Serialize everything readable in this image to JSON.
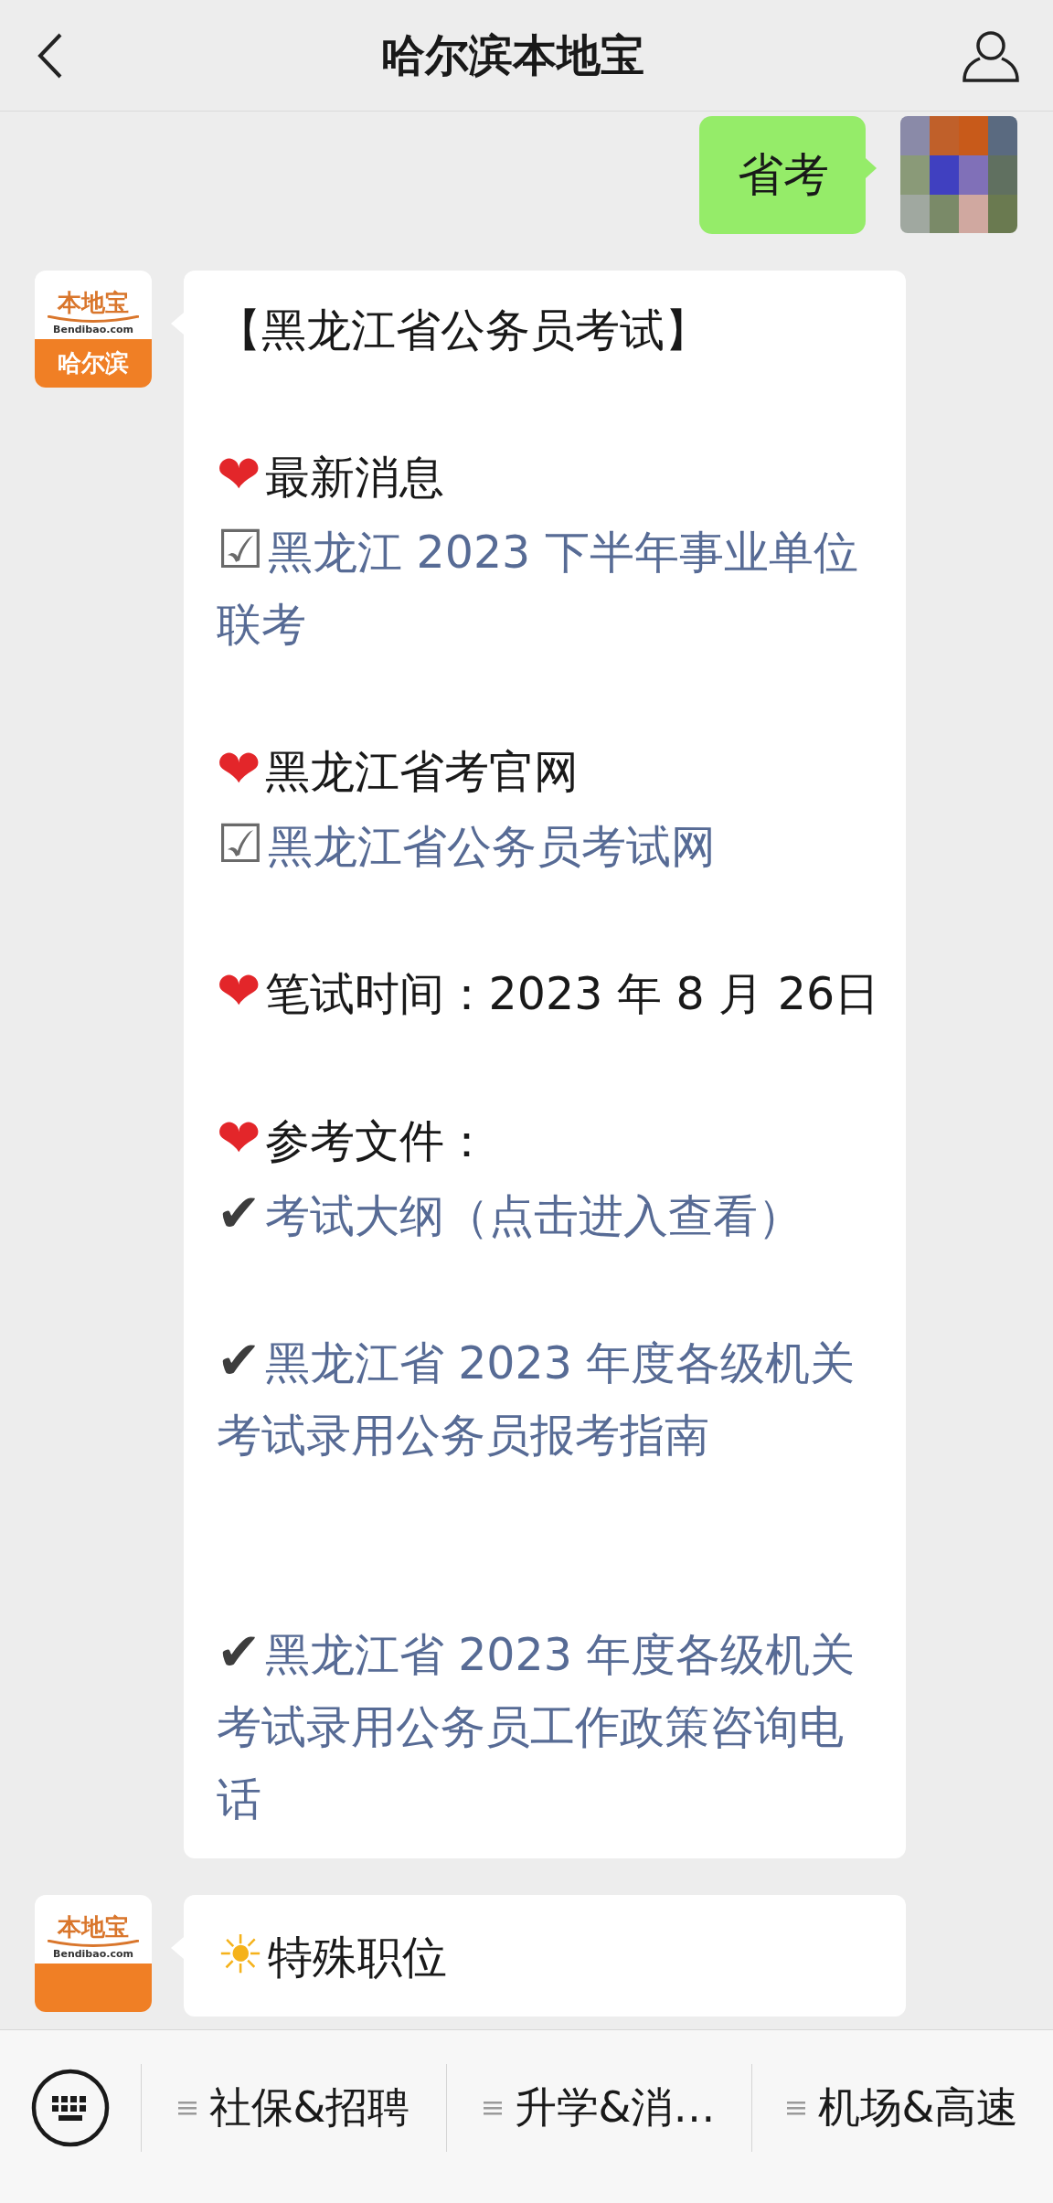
{
  "header": {
    "title": "哈尔滨本地宝"
  },
  "messages": [
    {
      "kind": "outgoing",
      "text": "省考"
    },
    {
      "kind": "incoming",
      "avatar_logo": [
        "本地宝",
        "Bendibao.com",
        "哈尔滨"
      ],
      "lines": [
        {
          "kind": "title",
          "text": "【黑龙江省公务员考试】"
        },
        {
          "kind": "blank"
        },
        {
          "kind": "heading",
          "text": "❤最新消息"
        },
        {
          "kind": "boxlink",
          "text": "☑黑龙江 2023 下半年事业单位联考"
        },
        {
          "kind": "blank"
        },
        {
          "kind": "heading",
          "text": "❤黑龙江省考官网"
        },
        {
          "kind": "boxlink",
          "text": "☑黑龙江省公务员考试网"
        },
        {
          "kind": "blank"
        },
        {
          "kind": "heading",
          "text": "❤笔试时间：2023 年 8 月 26日"
        },
        {
          "kind": "blank"
        },
        {
          "kind": "heading",
          "text": "❤参考文件："
        },
        {
          "kind": "ticklink",
          "text": "✔考试大纲（点击进入查看）"
        },
        {
          "kind": "blank"
        },
        {
          "kind": "ticklink",
          "text": "✔黑龙江省 2023 年度各级机关考试录用公务员报考指南"
        },
        {
          "kind": "blank"
        },
        {
          "kind": "blank"
        },
        {
          "kind": "ticklink",
          "text": "✔黑龙江省 2023 年度各级机关考试录用公务员工作政策咨询电话"
        }
      ]
    },
    {
      "kind": "incoming",
      "avatar_logo": [
        "本地宝",
        "Bendibao.com"
      ],
      "lines": [
        {
          "kind": "sunheading",
          "text": "☀特殊职位"
        }
      ]
    }
  ],
  "menu": {
    "items": [
      {
        "label": "社保&招聘"
      },
      {
        "label": "升学&消…"
      },
      {
        "label": "机场&高速"
      }
    ]
  }
}
